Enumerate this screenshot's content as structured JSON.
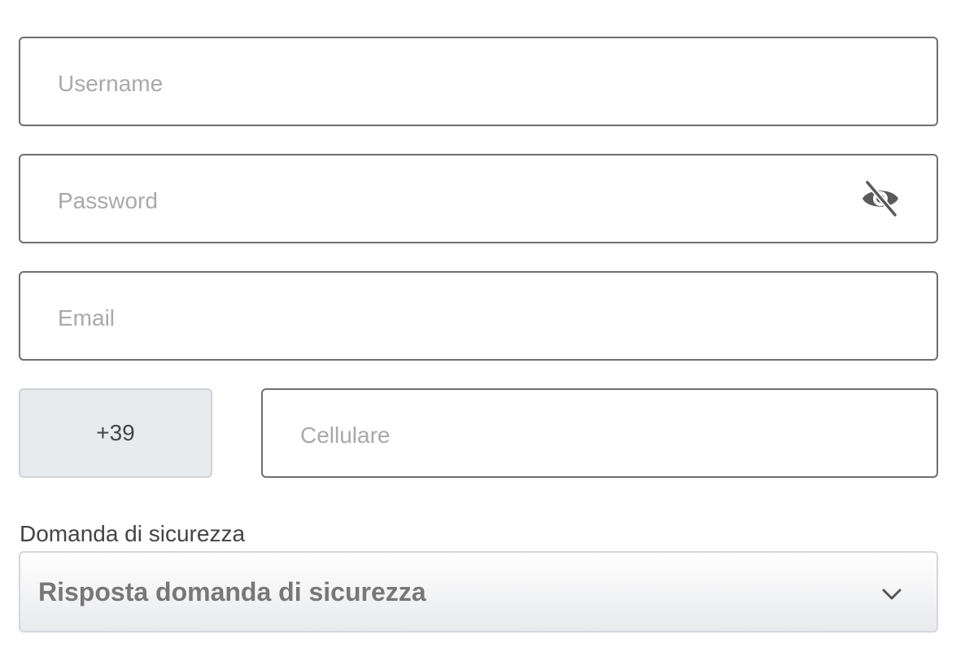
{
  "form": {
    "username": {
      "placeholder": "Username",
      "value": ""
    },
    "password": {
      "placeholder": "Password",
      "value": "",
      "toggle_icon": "eye-slash-icon"
    },
    "email": {
      "placeholder": "Email",
      "value": ""
    },
    "phone": {
      "country_code": "+39",
      "placeholder": "Cellulare",
      "value": ""
    },
    "security_question": {
      "label": "Domanda di sicurezza",
      "selected": "Risposta domanda di sicurezza",
      "dropdown_icon": "chevron-down-icon"
    }
  },
  "colors": {
    "border": "#6f6f6f",
    "placeholder": "#a9a9a9",
    "prefix_bg": "#e8ebee",
    "text": "#444444",
    "select_text": "#777777"
  }
}
